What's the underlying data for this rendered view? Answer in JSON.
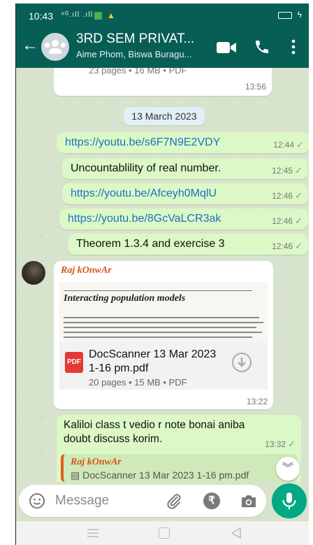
{
  "status_bar": {
    "time": "10:43",
    "signal": "⁴ᴳ.ıll .ıll"
  },
  "header": {
    "back_icon": "arrow-left-icon",
    "title": "3RD SEM PRIVAT...",
    "subtitle": "Aime Phom, Biswa Buragu...",
    "actions": [
      "video-call-icon",
      "voice-call-icon",
      "more-options-icon"
    ]
  },
  "messages": {
    "partial_top": {
      "doc_info": "23 pages • 16 MB • PDF",
      "time": "13:56"
    },
    "date_chip": "13 March 2023",
    "outgoing": [
      {
        "text": "https://youtu.be/s6F7N9E2VDY",
        "time": "12:44",
        "is_link": true
      },
      {
        "text": "Uncountablility of real number.",
        "time": "12:45",
        "is_link": false
      },
      {
        "text": "https://youtu.be/Afceyh0MqlU",
        "time": "12:46",
        "is_link": true
      },
      {
        "text": "https://youtu.be/8GcVaLCR3ak",
        "time": "12:46",
        "is_link": true
      },
      {
        "text": "Theorem 1.3.4 and exercise 3",
        "time": "12:46",
        "is_link": false
      }
    ],
    "tick": "✓",
    "document": {
      "sender": "Raj kOnwAr",
      "preview_title": "Interacting population models",
      "file_name": "DocScanner 13 Mar 2023 1-16 pm.pdf",
      "file_info": "20 pages • 15 MB • PDF",
      "pdf_badge": "PDF",
      "time": "13:22"
    },
    "reply": {
      "text_line1": "Kaliloi class t vedio r note bonai aniba",
      "text_line2": "doubt discuss korim.",
      "time": "13:32",
      "quoted_sender": "Raj kOnwAr",
      "quoted_text": "▤ DocScanner 13 Mar 2023 1-16 pm.pdf"
    }
  },
  "composer": {
    "placeholder": "Message",
    "rupee_symbol": "₹"
  },
  "colors": {
    "header_bg": "#075e54",
    "outgoing_bubble": "#dcf8c6",
    "link": "#1b72c0",
    "mic_button": "#00a884",
    "sender_name": "#d4561d"
  }
}
